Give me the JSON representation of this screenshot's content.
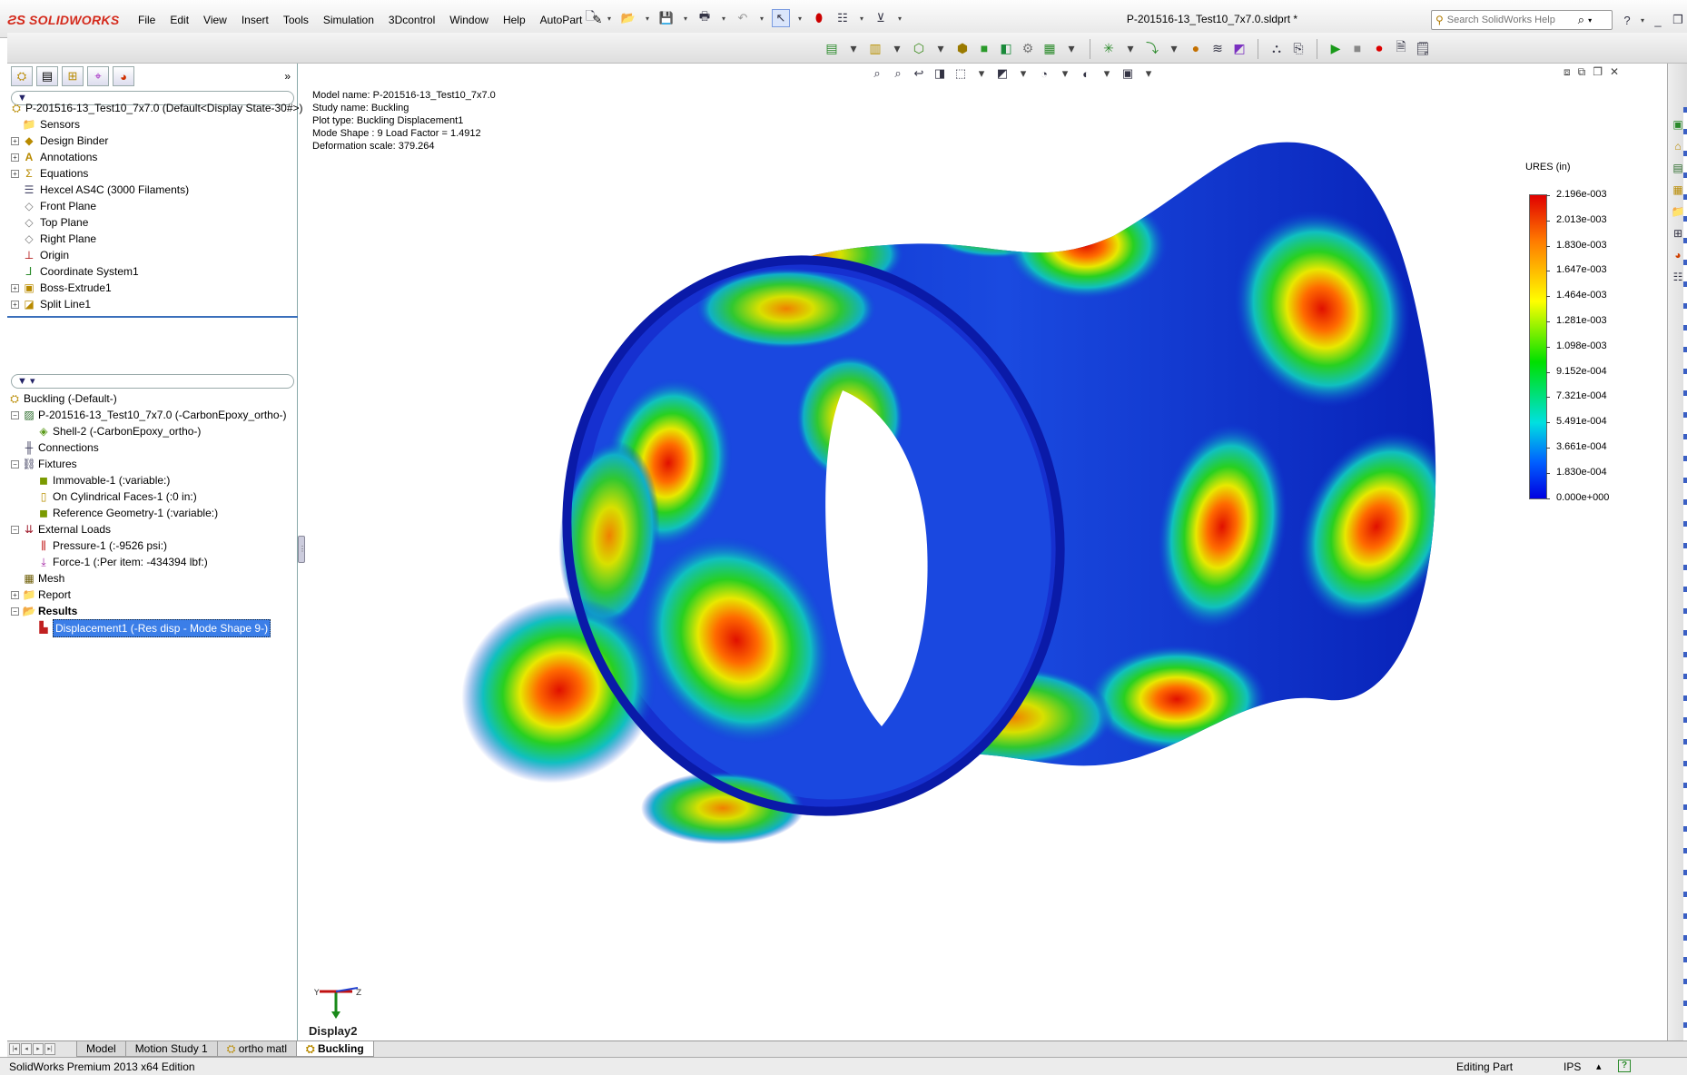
{
  "app": {
    "brand": "SOLIDWORKS",
    "document_title": "P-201516-13_Test10_7x7.0.sldprt *"
  },
  "menu": [
    "File",
    "Edit",
    "View",
    "Insert",
    "Tools",
    "Simulation",
    "3Dcontrol",
    "Window",
    "Help",
    "AutoPart"
  ],
  "search": {
    "placeholder": "Search SolidWorks Help"
  },
  "feature_tree": {
    "filter": "",
    "root": "P-201516-13_Test10_7x7.0  (Default<Display State-30#>)",
    "items": [
      "Sensors",
      "Design Binder",
      "Annotations",
      "Equations",
      "Hexcel AS4C (3000 Filaments)",
      "Front Plane",
      "Top Plane",
      "Right Plane",
      "Origin",
      "Coordinate System1",
      "Boss-Extrude1",
      "Split Line1"
    ]
  },
  "sim_tree": {
    "study": "Buckling (-Default-)",
    "part": "P-201516-13_Test10_7x7.0 (-CarbonEpoxy_ortho-)",
    "shell": "Shell-2 (-CarbonEpoxy_ortho-)",
    "connections": "Connections",
    "fixtures": "Fixtures",
    "fixture_items": [
      "Immovable-1 (:variable:)",
      "On Cylindrical Faces-1 (:0 in:)",
      "Reference Geometry-1 (:variable:)"
    ],
    "external_loads": "External Loads",
    "load_items": [
      "Pressure-1 (:-9526 psi:)",
      "Force-1 (:Per item: -434394 lbf:)"
    ],
    "mesh": "Mesh",
    "report": "Report",
    "results": "Results",
    "result_item": "Displacement1 (-Res disp - Mode Shape 9-)"
  },
  "plot_info": {
    "model_name": "Model name: P-201516-13_Test10_7x7.0",
    "study_name": "Study name: Buckling",
    "plot_type": "Plot type: Buckling Displacement1",
    "mode_shape": "Mode Shape : 9  Load Factor = 1.4912",
    "deformation": "Deformation scale: 379.264"
  },
  "legend": {
    "title": "URES (in)",
    "ticks": [
      "2.196e-003",
      "2.013e-003",
      "1.830e-003",
      "1.647e-003",
      "1.464e-003",
      "1.281e-003",
      "1.098e-003",
      "9.152e-004",
      "7.321e-004",
      "5.491e-004",
      "3.661e-004",
      "1.830e-004",
      "0.000e+000"
    ]
  },
  "triad": {
    "label": "Display2"
  },
  "bottom_tabs": [
    "Model",
    "Motion Study 1",
    "ortho matl",
    "Buckling"
  ],
  "status": {
    "left": "SolidWorks Premium 2013 x64 Edition",
    "mode": "Editing Part",
    "units": "IPS"
  },
  "colors": {
    "accent": "#3b7ee8",
    "brand": "#d42a1c",
    "hot": "#e00000",
    "cold": "#0000e0"
  }
}
